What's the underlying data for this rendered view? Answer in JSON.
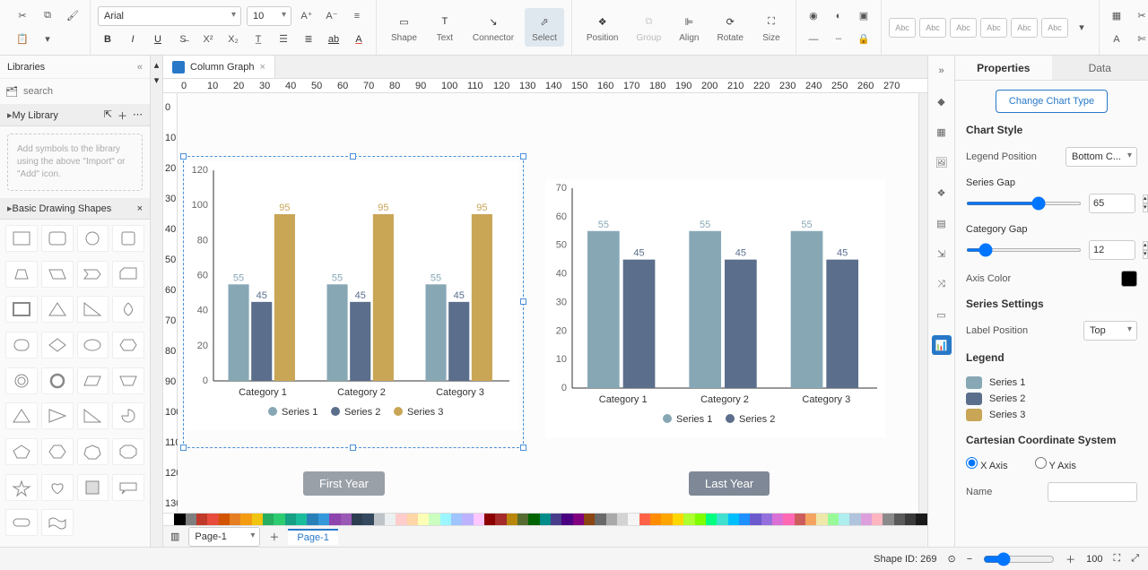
{
  "toolbar": {
    "font": "Arial",
    "font_size": "10",
    "labels": {
      "shape": "Shape",
      "text": "Text",
      "connector": "Connector",
      "select": "Select",
      "position": "Position",
      "group": "Group",
      "align": "Align",
      "rotate": "Rotate",
      "size": "Size"
    },
    "style_placeholder": "Abc"
  },
  "libraries": {
    "title": "Libraries",
    "search_placeholder": "search",
    "mylib": "My Library",
    "drop_hint": "Add symbols to the library using the above \"Import\" or \"Add\" icon.",
    "basic": "Basic Drawing Shapes"
  },
  "tab": {
    "name": "Column Graph"
  },
  "chart_data": [
    {
      "title": "First Year",
      "type": "bar",
      "categories": [
        "Category 1",
        "Category 2",
        "Category 3"
      ],
      "series": [
        {
          "name": "Series 1",
          "values": [
            55,
            55,
            55
          ],
          "color": "#87a7b5"
        },
        {
          "name": "Series 2",
          "values": [
            45,
            45,
            45
          ],
          "color": "#5b6e8c"
        },
        {
          "name": "Series 3",
          "values": [
            95,
            95,
            95
          ],
          "color": "#c9a556"
        }
      ],
      "ylim": [
        0,
        120
      ],
      "yticks": [
        0,
        20,
        40,
        60,
        80,
        100,
        120
      ]
    },
    {
      "title": "Last Year",
      "type": "bar",
      "categories": [
        "Category 1",
        "Category 2",
        "Category 3"
      ],
      "series": [
        {
          "name": "Series 1",
          "values": [
            55,
            55,
            55
          ],
          "color": "#87a7b5"
        },
        {
          "name": "Series 2",
          "values": [
            45,
            45,
            45
          ],
          "color": "#5b6e8c"
        }
      ],
      "ylim": [
        0,
        70
      ],
      "yticks": [
        0,
        10,
        20,
        30,
        40,
        50,
        60,
        70
      ]
    }
  ],
  "properties": {
    "tabs": {
      "properties": "Properties",
      "data": "Data"
    },
    "change_btn": "Change Chart Type",
    "chart_style": "Chart Style",
    "legend_pos_label": "Legend Position",
    "legend_pos_value": "Bottom C...",
    "series_gap_label": "Series Gap",
    "series_gap_value": "65",
    "cat_gap_label": "Category Gap",
    "cat_gap_value": "12",
    "axis_color_label": "Axis Color",
    "axis_color": "#000000",
    "series_settings": "Series Settings",
    "label_pos_label": "Label Position",
    "label_pos_value": "Top",
    "legend_title": "Legend",
    "legend": [
      {
        "name": "Series 1",
        "color": "#87a7b5"
      },
      {
        "name": "Series 2",
        "color": "#5b6e8c"
      },
      {
        "name": "Series 3",
        "color": "#c9a556"
      }
    ],
    "cartesian": "Cartesian Coordinate System",
    "xaxis": "X Axis",
    "yaxis": "Y Axis",
    "name_label": "Name"
  },
  "pagebar": {
    "page": "Page-1",
    "page_tab": "Page-1"
  },
  "statusbar": {
    "shape_id": "Shape ID: 269",
    "zoom": "100"
  },
  "ruler_h": [
    0,
    10,
    20,
    30,
    40,
    50,
    60,
    70,
    80,
    90,
    100,
    110,
    120,
    130,
    140,
    150,
    160,
    170,
    180,
    190,
    200,
    210,
    220,
    230,
    240,
    250,
    260,
    270
  ],
  "ruler_v": [
    0,
    10,
    20,
    30,
    40,
    50,
    60,
    70,
    80,
    90,
    100,
    110,
    120,
    130
  ],
  "palette": [
    "#ffffff",
    "#000000",
    "#7f7f7f",
    "#c0392b",
    "#e74c3c",
    "#d35400",
    "#e67e22",
    "#f39c12",
    "#f1c40f",
    "#27ae60",
    "#2ecc71",
    "#16a085",
    "#1abc9c",
    "#2980b9",
    "#3498db",
    "#8e44ad",
    "#9b59b6",
    "#2c3e50",
    "#34495e",
    "#bdc3c7",
    "#ecf0f1",
    "#ffcccc",
    "#ffd6a5",
    "#fdffb6",
    "#caffbf",
    "#9bf6ff",
    "#a0c4ff",
    "#bdb2ff",
    "#ffc6ff",
    "#8b0000",
    "#a52a2a",
    "#b8860b",
    "#556b2f",
    "#006400",
    "#008b8b",
    "#483d8b",
    "#4b0082",
    "#800080",
    "#8b4513",
    "#696969",
    "#a9a9a9",
    "#d3d3d3",
    "#f5f5f5",
    "#ff6347",
    "#ff8c00",
    "#ffa500",
    "#ffd700",
    "#adff2f",
    "#7fff00",
    "#00ff7f",
    "#40e0d0",
    "#00bfff",
    "#1e90ff",
    "#6a5acd",
    "#9370db",
    "#da70d6",
    "#ff69b4",
    "#cd5c5c",
    "#f4a460",
    "#eee8aa",
    "#98fb98",
    "#afeeee",
    "#b0c4de",
    "#dda0dd",
    "#ffb6c1",
    "#8a8a8a",
    "#5a5a5a",
    "#3a3a3a",
    "#1a1a1a"
  ]
}
